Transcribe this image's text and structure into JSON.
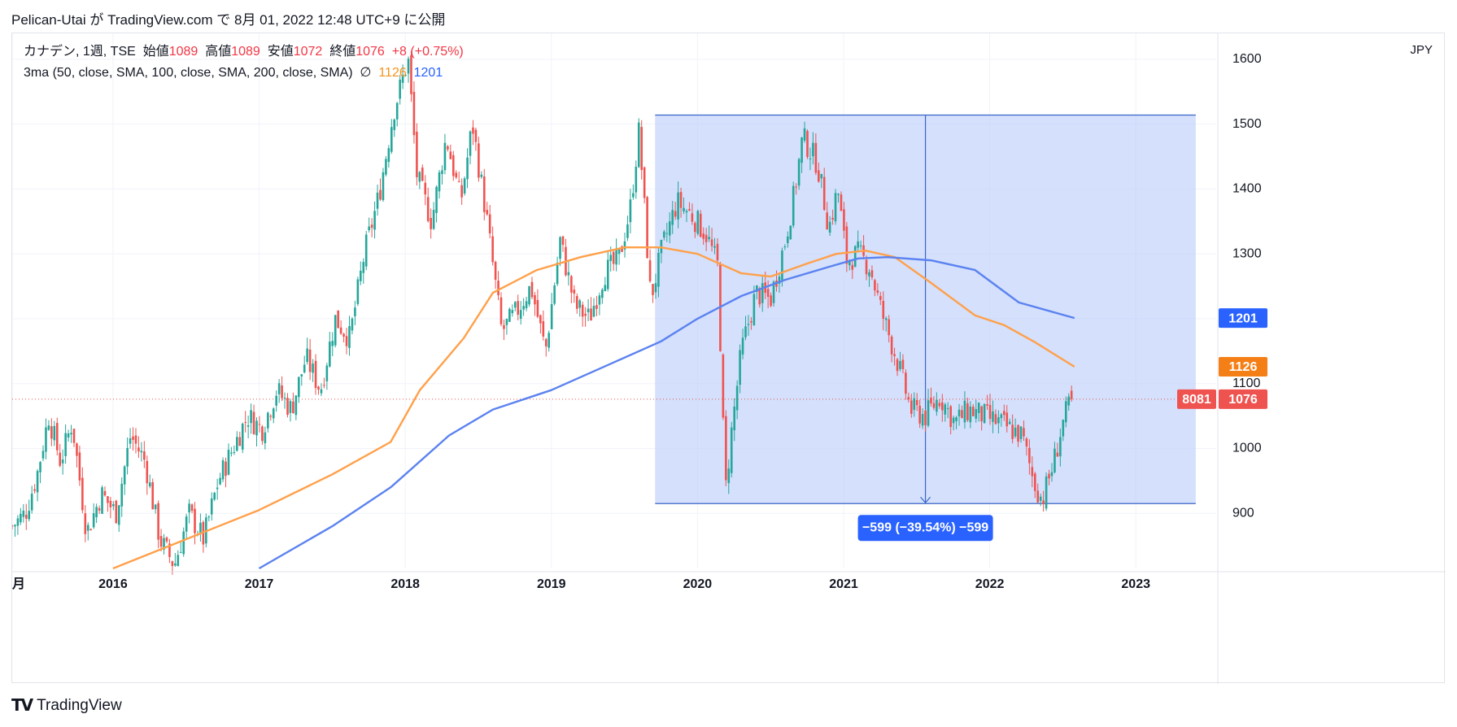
{
  "publish_line": "Pelican-Utai が TradingView.com で 8月 01, 2022 12:48 UTC+9 に公開",
  "legend": {
    "symbol": "カナデン, 1週, TSE",
    "open_label": "始値",
    "open": "1089",
    "high_label": "高値",
    "high": "1089",
    "low_label": "安値",
    "low": "1072",
    "close_label": "終値",
    "close": "1076",
    "change": "+8 (+0.75%)",
    "ma_label": "3ma (50, close, SMA, 100, close, SMA, 200, close, SMA)",
    "ma_eye": "∅",
    "ma1_value": "1126",
    "ma2_value": "1201"
  },
  "currency": "JPY",
  "brand": "TradingView",
  "colors": {
    "up": "#26a69a",
    "down": "#ef5350",
    "ma_orange": "#ffa04a",
    "ma_blue": "#5b82f0",
    "range_fill": "#bdd0fb",
    "range_line": "#3a65c7",
    "badge_blue": "#2962ff",
    "badge_orange": "#f57f17",
    "badge_red": "#ef5350",
    "measure_bg": "#2962ff"
  },
  "chart_data": {
    "type": "candlestick",
    "timeframe": "weekly",
    "x_labels": [
      "月",
      "2016",
      "2017",
      "2018",
      "2019",
      "2020",
      "2021",
      "2022",
      "2023"
    ],
    "y_ticks": [
      900,
      1000,
      1100,
      1200,
      1300,
      1400,
      1500,
      1600
    ],
    "ylim": [
      815,
      1640
    ],
    "xlim": [
      2015.31,
      2023.55
    ],
    "price_path": [
      [
        2015.31,
        880
      ],
      [
        2015.4,
        900
      ],
      [
        2015.48,
        960
      ],
      [
        2015.56,
        1050
      ],
      [
        2015.64,
        980
      ],
      [
        2015.72,
        1040
      ],
      [
        2015.82,
        870
      ],
      [
        2015.92,
        930
      ],
      [
        2016.02,
        900
      ],
      [
        2016.12,
        1020
      ],
      [
        2016.22,
        980
      ],
      [
        2016.32,
        860
      ],
      [
        2016.42,
        820
      ],
      [
        2016.52,
        900
      ],
      [
        2016.62,
        860
      ],
      [
        2016.72,
        950
      ],
      [
        2016.82,
        1000
      ],
      [
        2016.92,
        1050
      ],
      [
        2017.02,
        1030
      ],
      [
        2017.12,
        1090
      ],
      [
        2017.22,
        1060
      ],
      [
        2017.32,
        1140
      ],
      [
        2017.42,
        1090
      ],
      [
        2017.52,
        1200
      ],
      [
        2017.62,
        1170
      ],
      [
        2017.72,
        1300
      ],
      [
        2017.82,
        1390
      ],
      [
        2017.92,
        1520
      ],
      [
        2018.02,
        1600
      ],
      [
        2018.08,
        1420
      ],
      [
        2018.18,
        1350
      ],
      [
        2018.28,
        1480
      ],
      [
        2018.38,
        1380
      ],
      [
        2018.46,
        1500
      ],
      [
        2018.56,
        1350
      ],
      [
        2018.66,
        1180
      ],
      [
        2018.76,
        1210
      ],
      [
        2018.86,
        1250
      ],
      [
        2018.96,
        1150
      ],
      [
        2019.06,
        1320
      ],
      [
        2019.16,
        1220
      ],
      [
        2019.26,
        1200
      ],
      [
        2019.36,
        1270
      ],
      [
        2019.46,
        1290
      ],
      [
        2019.54,
        1370
      ],
      [
        2019.6,
        1490
      ],
      [
        2019.68,
        1230
      ],
      [
        2019.76,
        1310
      ],
      [
        2019.86,
        1380
      ],
      [
        2019.96,
        1360
      ],
      [
        2020.06,
        1330
      ],
      [
        2020.14,
        1280
      ],
      [
        2020.19,
        930
      ],
      [
        2020.23,
        1020
      ],
      [
        2020.3,
        1150
      ],
      [
        2020.4,
        1240
      ],
      [
        2020.5,
        1230
      ],
      [
        2020.6,
        1320
      ],
      [
        2020.66,
        1390
      ],
      [
        2020.72,
        1480
      ],
      [
        2020.82,
        1440
      ],
      [
        2020.9,
        1340
      ],
      [
        2020.96,
        1400
      ],
      [
        2021.02,
        1290
      ],
      [
        2021.1,
        1300
      ],
      [
        2021.18,
        1280
      ],
      [
        2021.26,
        1210
      ],
      [
        2021.36,
        1140
      ],
      [
        2021.46,
        1060
      ],
      [
        2021.56,
        1050
      ],
      [
        2021.66,
        1080
      ],
      [
        2021.76,
        1040
      ],
      [
        2021.86,
        1060
      ],
      [
        2021.96,
        1050
      ],
      [
        2022.06,
        1040
      ],
      [
        2022.14,
        1030
      ],
      [
        2022.22,
        1020
      ],
      [
        2022.3,
        950
      ],
      [
        2022.36,
        920
      ],
      [
        2022.44,
        980
      ],
      [
        2022.5,
        1040
      ],
      [
        2022.56,
        1076
      ]
    ],
    "last": {
      "open": 1089,
      "high": 1089,
      "low": 1072,
      "close": 1076,
      "change": 8,
      "change_pct": 0.75
    },
    "series": [
      {
        "name": "50",
        "values_x": [
          2016.0,
          2016.5,
          2017.0,
          2017.5,
          2017.9,
          2018.1,
          2018.4,
          2018.6,
          2018.9,
          2019.2,
          2019.5,
          2019.75,
          2020.0,
          2020.3,
          2020.5,
          2020.75,
          2020.95,
          2021.15,
          2021.35,
          2021.6,
          2021.9,
          2022.1,
          2022.3,
          2022.58
        ],
        "values_y": [
          815,
          860,
          905,
          960,
          1010,
          1090,
          1170,
          1240,
          1275,
          1295,
          1310,
          1310,
          1300,
          1270,
          1265,
          1285,
          1300,
          1305,
          1295,
          1255,
          1205,
          1190,
          1165,
          1126
        ]
      },
      {
        "name": "100",
        "values_x": [
          2017.0,
          2017.5,
          2017.9,
          2018.3,
          2018.6,
          2019.0,
          2019.4,
          2019.75,
          2020.0,
          2020.3,
          2020.6,
          2020.9,
          2021.1,
          2021.3,
          2021.6,
          2021.9,
          2022.2,
          2022.58
        ],
        "values_y": [
          815,
          880,
          940,
          1020,
          1060,
          1090,
          1130,
          1165,
          1200,
          1235,
          1260,
          1280,
          1293,
          1295,
          1290,
          1275,
          1225,
          1201
        ]
      }
    ],
    "ranges": [
      {
        "type": "price_range",
        "x_start": 2019.71,
        "x_end": 2023.41,
        "y_top": 1514,
        "y_bottom": 915
      }
    ],
    "annotations": [
      {
        "text": "−599 (−39.54%) −599",
        "x": 2021.56
      }
    ],
    "price_badges": [
      {
        "label": "1201",
        "color": "blue"
      },
      {
        "label": "1126",
        "color": "orange"
      },
      {
        "label": "8081",
        "color": "red"
      },
      {
        "label": "1076",
        "color": "red"
      }
    ],
    "last_price": 1076
  }
}
